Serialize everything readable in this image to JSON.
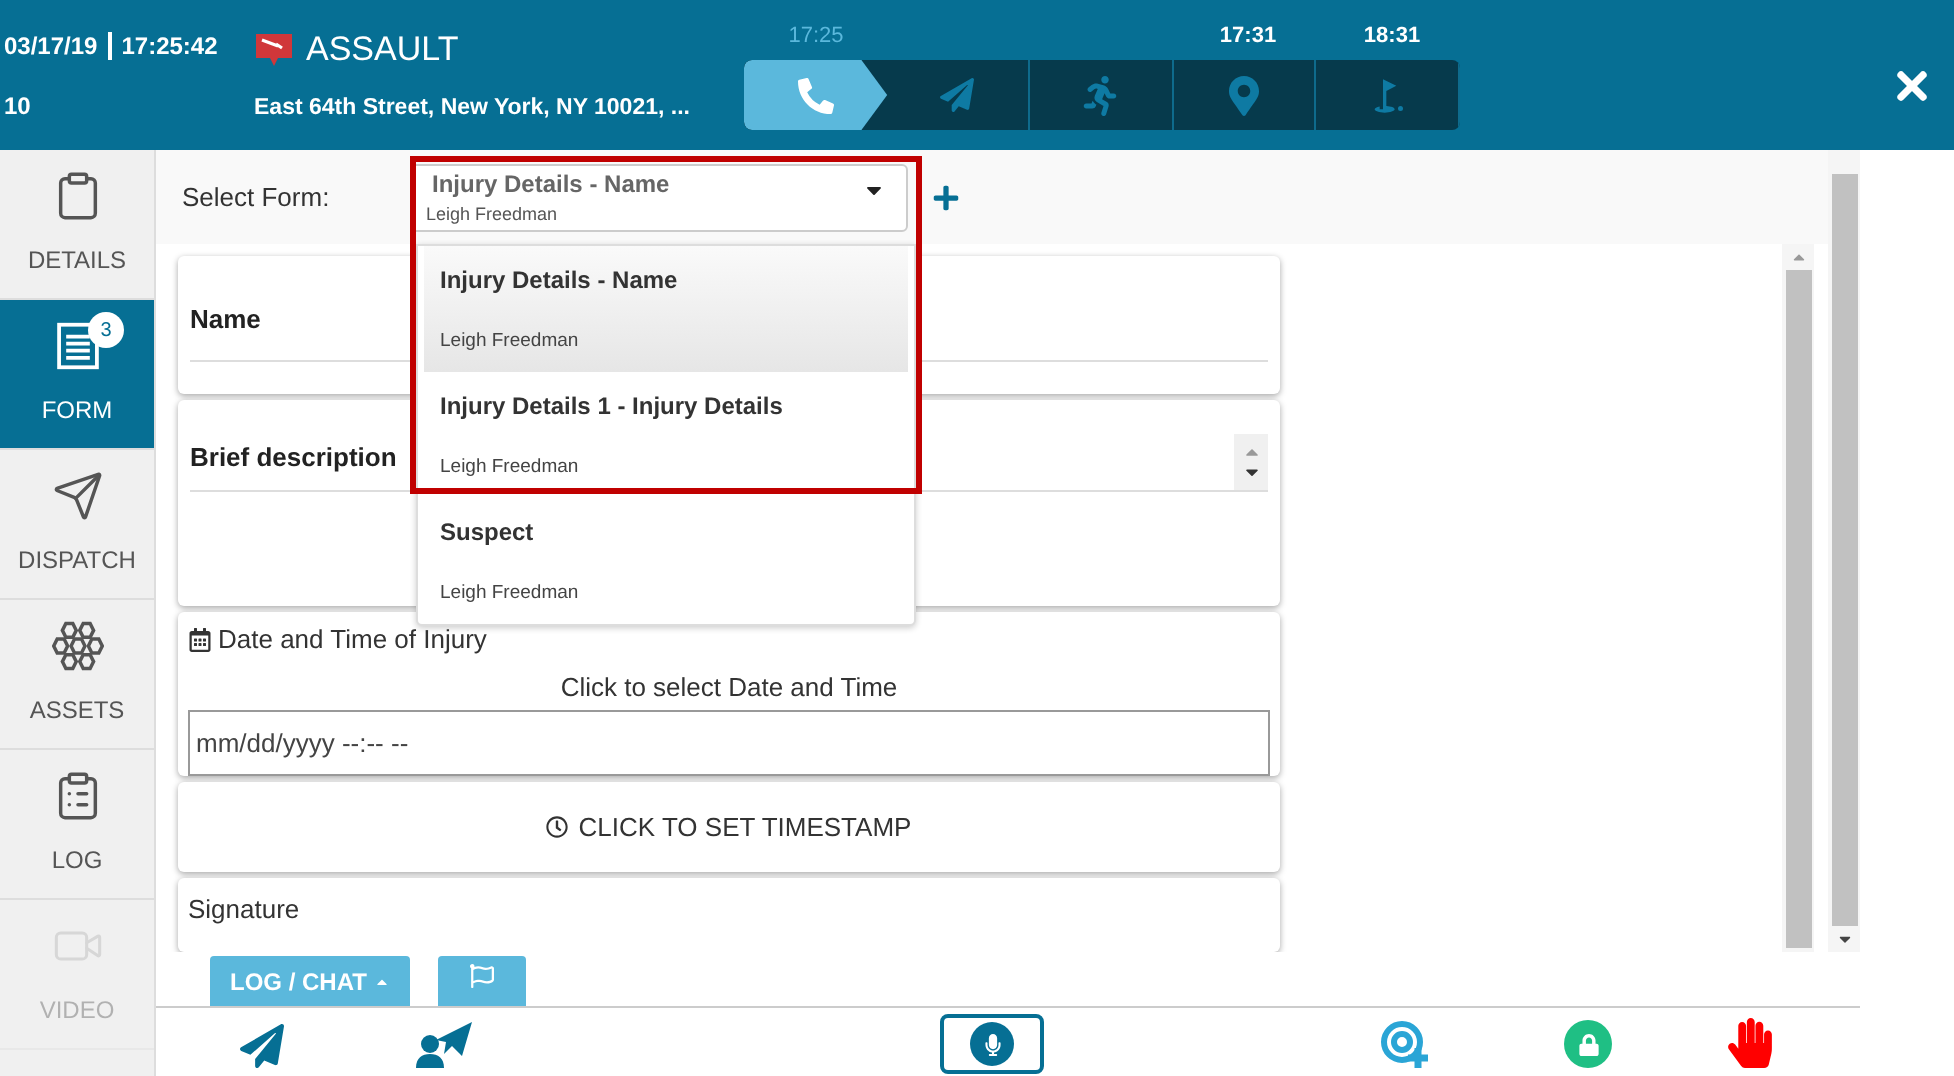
{
  "header": {
    "date": "03/17/19",
    "time": "17:25:42",
    "number": "10",
    "incident": "ASSAULT",
    "address": "East 64th Street, New York, NY 10021, ..."
  },
  "timeline": [
    {
      "kind": "call",
      "time": "17:25",
      "selected": true
    },
    {
      "kind": "dispatch",
      "selected": false
    },
    {
      "kind": "enroute",
      "selected": false
    },
    {
      "kind": "arrived",
      "time": "17:31",
      "selected": false
    },
    {
      "kind": "finished",
      "time": "18:31",
      "selected": false
    }
  ],
  "sidebar": {
    "items": [
      {
        "kind": "details",
        "label": "DETAILS",
        "selected": false,
        "disabled": false
      },
      {
        "kind": "form",
        "label": "FORM",
        "selected": true,
        "disabled": false,
        "badge": "3"
      },
      {
        "kind": "dispatch",
        "label": "DISPATCH",
        "selected": false,
        "disabled": false
      },
      {
        "kind": "assets",
        "label": "ASSETS",
        "selected": false,
        "disabled": false
      },
      {
        "kind": "log",
        "label": "LOG",
        "selected": false,
        "disabled": false
      },
      {
        "kind": "video",
        "label": "VIDEO",
        "selected": false,
        "disabled": true
      }
    ]
  },
  "form_select": {
    "label": "Select Form:",
    "value": "Injury Details - Name",
    "value_subtitle": "Leigh Freedman",
    "options": [
      {
        "title": "Injury Details - Name",
        "subtitle": "Leigh Freedman",
        "selected": true
      },
      {
        "title": "Injury Details 1 - Injury Details",
        "subtitle": "Leigh Freedman",
        "selected": false
      },
      {
        "title": "Suspect",
        "subtitle": "Leigh Freedman",
        "selected": false
      }
    ]
  },
  "form": {
    "name_label": "Name",
    "description_label": "Brief description",
    "date_label": "Date and Time of Injury",
    "date_hint": "Click to select Date and Time",
    "date_placeholder": "mm/dd/yyyy --:-- --",
    "timestamp_button": "CLICK TO SET TIMESTAMP",
    "signature_label": "Signature"
  },
  "bottom_buttons": {
    "log_chat": "LOG / CHAT"
  }
}
